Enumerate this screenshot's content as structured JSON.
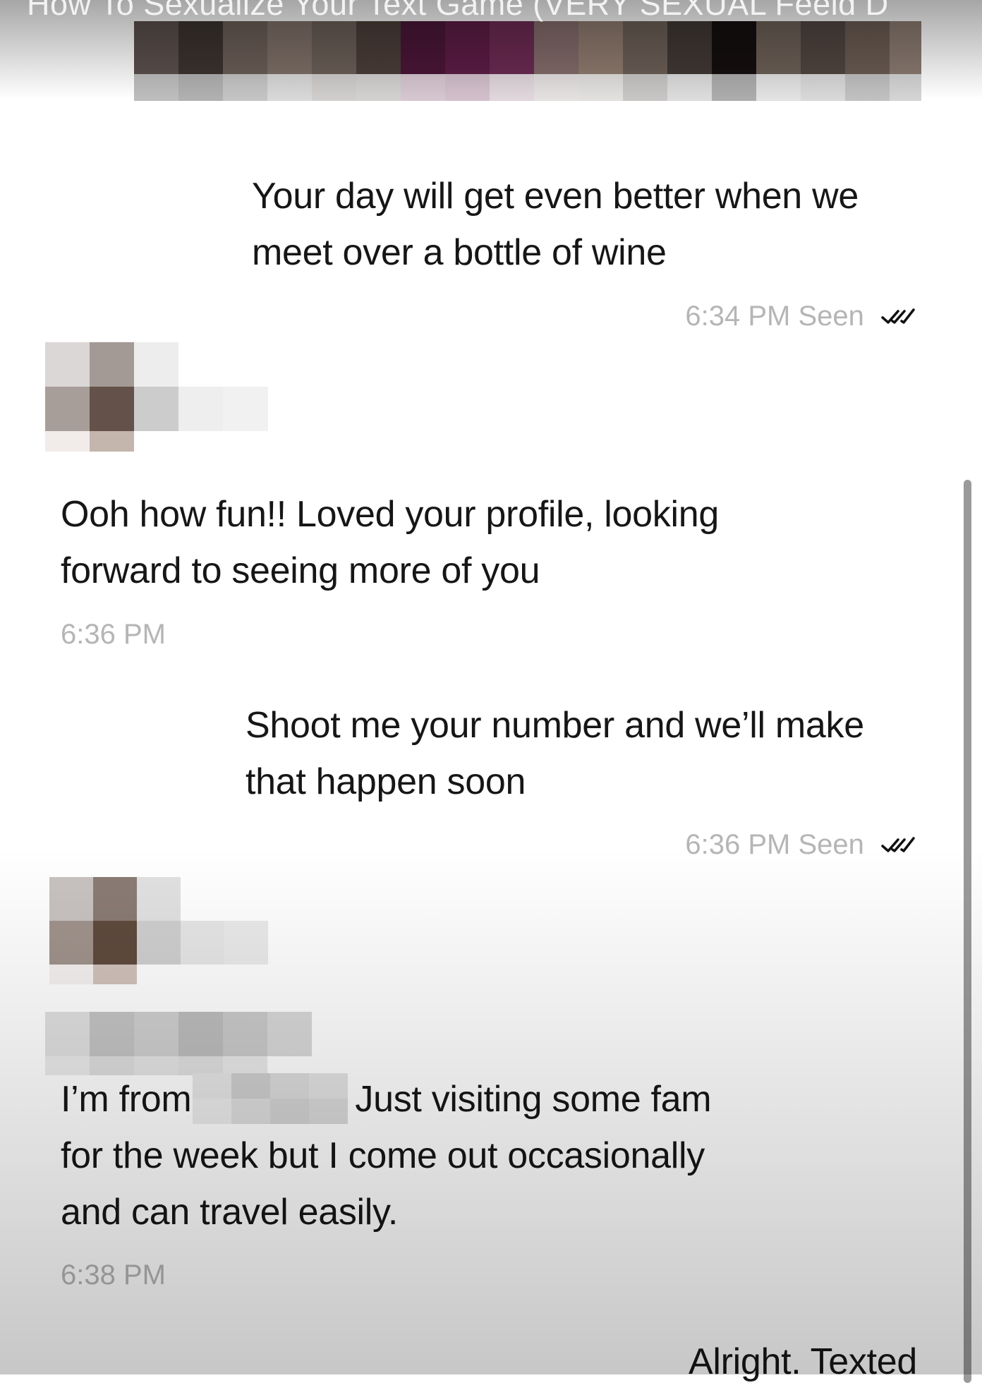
{
  "video": {
    "title": "How To Sexualize Your Text Game (VERY SEXUAL Feeld D"
  },
  "messages": [
    {
      "side": "sent",
      "lines": [
        "Your day will get even better when we",
        "meet over a bottle of wine"
      ],
      "time": "6:34 PM",
      "status": "Seen"
    },
    {
      "side": "received",
      "lines": [
        "Ooh how fun!! Loved your profile, looking",
        "forward to seeing more of you"
      ],
      "time": "6:36 PM"
    },
    {
      "side": "sent",
      "lines": [
        "Shoot me your number and we’ll make",
        "that happen soon"
      ],
      "time": "6:36 PM",
      "status": "Seen"
    },
    {
      "side": "received",
      "line1_before": "I’m from",
      "line1_after": "Just visiting some fam",
      "lines": [
        "for the week but I come out occasionally",
        "and can travel easily."
      ],
      "time": "6:38 PM"
    },
    {
      "side": "sent",
      "lines": [
        "Alright. Texted"
      ]
    }
  ],
  "icons": {
    "seen": "double-check-icon",
    "avatar": "pixelated-avatar"
  },
  "colors": {
    "text": "#161616",
    "meta": "#b5b5b5",
    "accent_pixel": "#5c1840"
  }
}
